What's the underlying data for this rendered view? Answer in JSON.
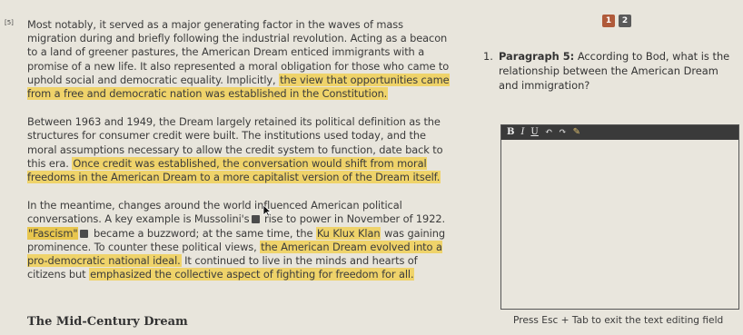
{
  "passage": {
    "para_marker": "[5]",
    "p1": {
      "t1": "Most notably, it served as a major generating factor in the waves of mass migration during and briefly following the industrial revolution. Acting as a beacon to a land of greener pastures, the American Dream enticed immigrants with a promise of a new life. It also represented a moral obligation for those who came to uphold social and democratic equality. Implicitly, ",
      "h1": "the view that opportunities came from a free and democratic nation was established in the Constitution."
    },
    "p2": {
      "t1": "Between 1963 and 1949, the Dream largely retained its political definition as the structures for consumer credit were built. The institutions used today, and the moral assumptions necessary to allow the credit system to function, date back to this era. ",
      "h1": "Once credit was established, the conversation would shift from moral freedoms in the American Dream to a more capitalist version of the Dream itself."
    },
    "p3": {
      "t1": "In the meantime, changes around the world influenced American political conversations. A key example is Mussolini's",
      "t2": " rise to power in November of 1922. ",
      "h1": "\"Fascism\"",
      "t3": " became a buzzword; at the same time, the ",
      "h2": "Ku Klux Klan",
      "t4": " was gaining prominence. To counter these political views, ",
      "h3": "the American Dream evolved into a pro-democratic national ideal.",
      "t5": " It continued to live in the minds and hearts of citizens but ",
      "h4": "emphasized the collective aspect of fighting for freedom for all."
    },
    "section_heading": "The Mid-Century Dream"
  },
  "pager": {
    "page1": "1",
    "page2": "2"
  },
  "question": {
    "number": "1.",
    "label": "Paragraph 5:",
    "text": " According to Bod, what is the relationship between the American Dream and immigration?"
  },
  "editor": {
    "toolbar": {
      "bold": "B",
      "italic": "I",
      "underline": "U",
      "undo": "↶",
      "redo": "↷",
      "pen": "✎"
    },
    "value": "",
    "hint": "Press Esc + Tab to exit the text editing field"
  }
}
